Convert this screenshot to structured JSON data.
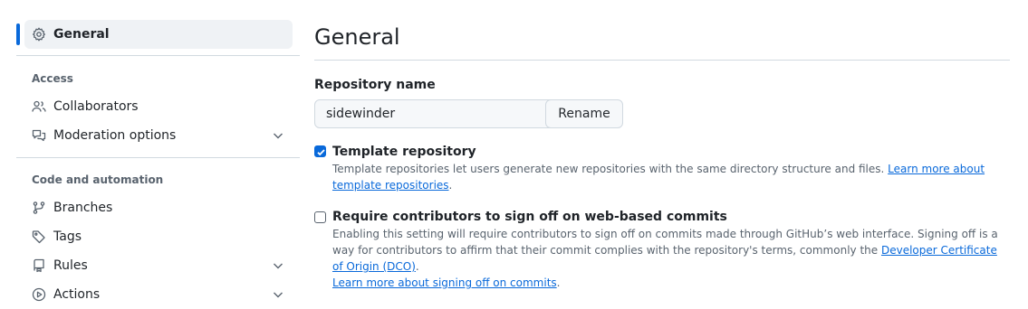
{
  "sidebar": {
    "active_item": {
      "label": "General",
      "icon": "gear-icon"
    },
    "sections": [
      {
        "header": "Access",
        "items": [
          {
            "label": "Collaborators",
            "icon": "people-icon",
            "expandable": false
          },
          {
            "label": "Moderation options",
            "icon": "comment-discussion-icon",
            "expandable": true
          }
        ]
      },
      {
        "header": "Code and automation",
        "items": [
          {
            "label": "Branches",
            "icon": "git-branch-icon",
            "expandable": false
          },
          {
            "label": "Tags",
            "icon": "tag-icon",
            "expandable": false
          },
          {
            "label": "Rules",
            "icon": "repo-push-icon",
            "expandable": true
          },
          {
            "label": "Actions",
            "icon": "play-icon",
            "expandable": true
          }
        ]
      }
    ]
  },
  "main": {
    "title": "General",
    "repo_name": {
      "label": "Repository name",
      "value": "sidewinder",
      "rename_button": "Rename"
    },
    "template_repository": {
      "checked": true,
      "title": "Template repository",
      "description": "Template repositories let users generate new repositories with the same directory structure and files.",
      "link_text": "Learn more about template repositories",
      "trailing": "."
    },
    "signoff": {
      "checked": false,
      "title": "Require contributors to sign off on web-based commits",
      "description": "Enabling this setting will require contributors to sign off on commits made through GitHub’s web interface. Signing off is a way for contributors to affirm that their commit complies with the repository's terms, commonly the",
      "dco_link_text": "Developer Certificate of Origin (DCO)",
      "after_dco": ".",
      "learn_more_link_text": "Learn more about signing off on commits",
      "trailing": "."
    }
  },
  "colors": {
    "accent": "#0969da",
    "text": "#1f2328",
    "muted": "#59636e",
    "border": "#d1d9e0",
    "active_bg": "#eff2f5"
  }
}
